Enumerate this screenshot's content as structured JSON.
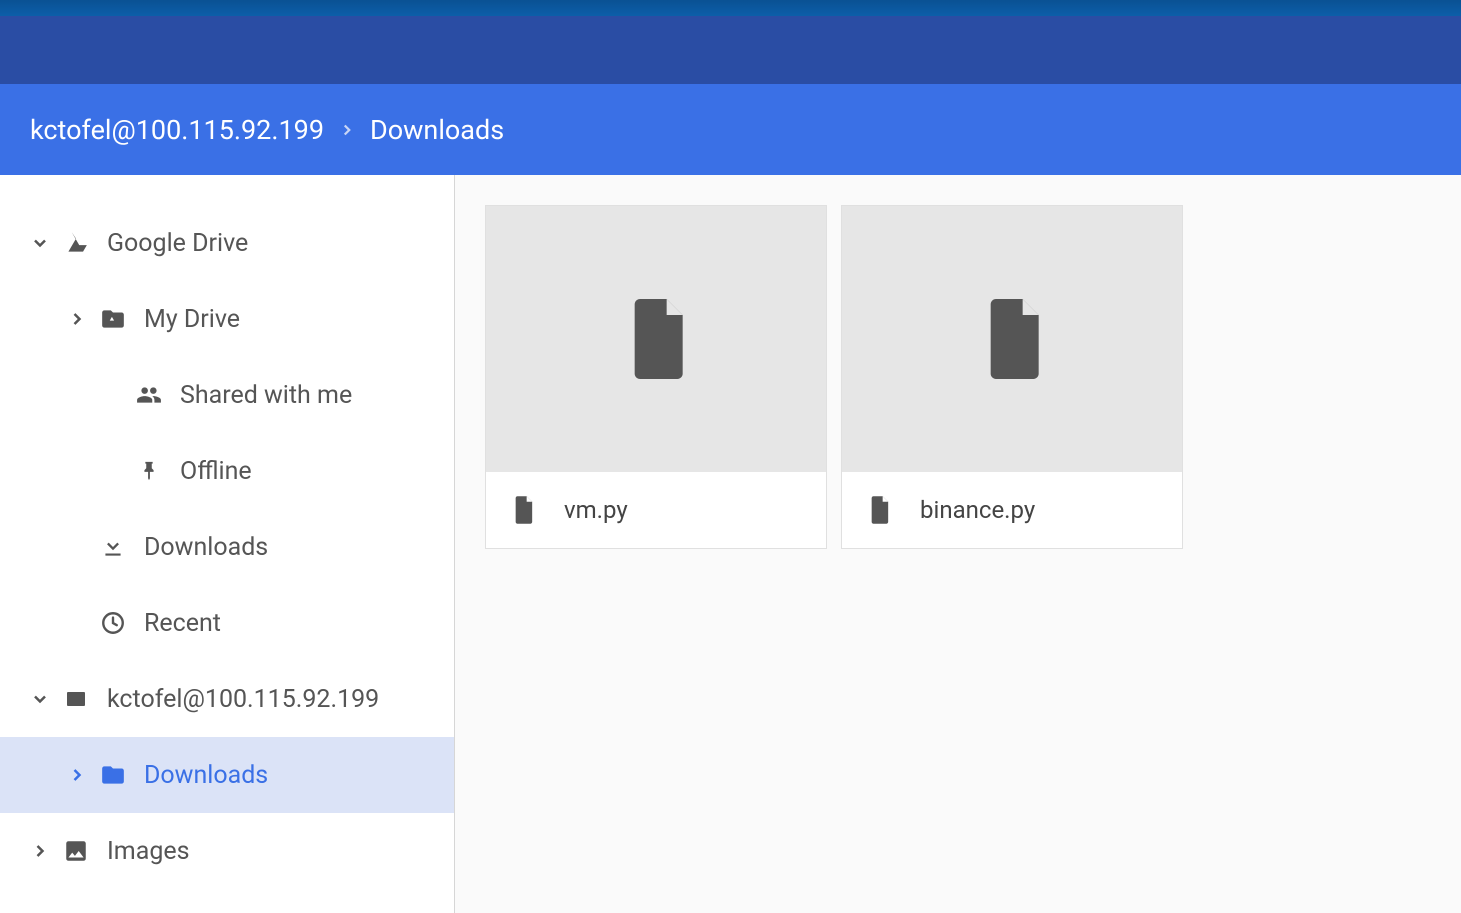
{
  "breadcrumb": {
    "root": "kctofel@100.115.92.199",
    "current": "Downloads"
  },
  "sidebar": {
    "google_drive": "Google Drive",
    "my_drive": "My Drive",
    "shared": "Shared with me",
    "offline": "Offline",
    "downloads": "Downloads",
    "recent": "Recent",
    "remote_host": "kctofel@100.115.92.199",
    "remote_downloads": "Downloads",
    "images": "Images"
  },
  "files": [
    {
      "name": "vm.py"
    },
    {
      "name": "binance.py"
    }
  ]
}
